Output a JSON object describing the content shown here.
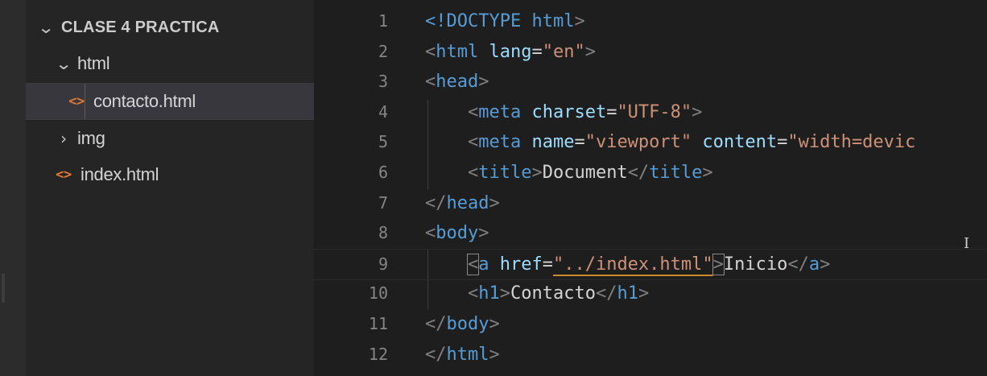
{
  "explorer": {
    "root_folder": "CLASE 4 PRACTICA",
    "items": [
      {
        "label": "html",
        "type": "folder",
        "expanded": true,
        "icon": "chevron-down-icon"
      },
      {
        "label": "contacto.html",
        "type": "file",
        "selected": true,
        "icon": "html-file-icon",
        "icon_glyph": "<>"
      },
      {
        "label": "img",
        "type": "folder",
        "expanded": false,
        "icon": "chevron-right-icon"
      },
      {
        "label": "index.html",
        "type": "file",
        "selected": false,
        "icon": "html-file-icon",
        "icon_glyph": "<>"
      }
    ]
  },
  "editor": {
    "line_numbers": [
      "1",
      "2",
      "3",
      "4",
      "5",
      "6",
      "7",
      "8",
      "9",
      "10",
      "11",
      "12"
    ],
    "lines": [
      [
        [
          "doc",
          "<!DOCTYPE "
        ],
        [
          "tag",
          "html"
        ],
        [
          "punct",
          ">"
        ]
      ],
      [
        [
          "punct",
          "<"
        ],
        [
          "tag",
          "html "
        ],
        [
          "attr",
          "lang"
        ],
        [
          "text",
          "="
        ],
        [
          "str",
          "\"en\""
        ],
        [
          "punct",
          ">"
        ]
      ],
      [
        [
          "punct",
          "<"
        ],
        [
          "tag",
          "head"
        ],
        [
          "punct",
          ">"
        ]
      ],
      [
        [
          "text",
          "    "
        ],
        [
          "punct",
          "<"
        ],
        [
          "tag",
          "meta "
        ],
        [
          "attr",
          "charset"
        ],
        [
          "text",
          "="
        ],
        [
          "str",
          "\"UTF-8\""
        ],
        [
          "punct",
          ">"
        ]
      ],
      [
        [
          "text",
          "    "
        ],
        [
          "punct",
          "<"
        ],
        [
          "tag",
          "meta "
        ],
        [
          "attr",
          "name"
        ],
        [
          "text",
          "="
        ],
        [
          "str",
          "\"viewport\" "
        ],
        [
          "attr",
          "content"
        ],
        [
          "text",
          "="
        ],
        [
          "str",
          "\"width=devic"
        ]
      ],
      [
        [
          "text",
          "    "
        ],
        [
          "punct",
          "<"
        ],
        [
          "tag",
          "title"
        ],
        [
          "punct",
          ">"
        ],
        [
          "text",
          "Document"
        ],
        [
          "punct",
          "</"
        ],
        [
          "tag",
          "title"
        ],
        [
          "punct",
          ">"
        ]
      ],
      [
        [
          "punct",
          "</"
        ],
        [
          "tag",
          "head"
        ],
        [
          "punct",
          ">"
        ]
      ],
      [
        [
          "punct",
          "<"
        ],
        [
          "tag",
          "body"
        ],
        [
          "punct",
          ">"
        ]
      ],
      [
        [
          "text",
          "    "
        ],
        [
          "punctbox",
          "<"
        ],
        [
          "tag",
          "a "
        ],
        [
          "attr",
          "href"
        ],
        [
          "text",
          "="
        ],
        [
          "strwarn",
          "\"../index.html\""
        ],
        [
          "punctbox",
          ">"
        ],
        [
          "text",
          "Inicio"
        ],
        [
          "punct",
          "</"
        ],
        [
          "tag",
          "a"
        ],
        [
          "punct",
          ">"
        ]
      ],
      [
        [
          "text",
          "    "
        ],
        [
          "punct",
          "<"
        ],
        [
          "tag",
          "h1"
        ],
        [
          "punct",
          ">"
        ],
        [
          "text",
          "Contacto"
        ],
        [
          "punct",
          "</"
        ],
        [
          "tag",
          "h1"
        ],
        [
          "punct",
          ">"
        ]
      ],
      [
        [
          "punct",
          "</"
        ],
        [
          "tag",
          "body"
        ],
        [
          "punct",
          ">"
        ]
      ],
      [
        [
          "punct",
          "</"
        ],
        [
          "tag",
          "html"
        ],
        [
          "punct",
          ">"
        ]
      ]
    ],
    "current_line": "9",
    "cursor_glyph": "I"
  },
  "colors": {
    "tag": "#569cd6",
    "attribute": "#9cdcfe",
    "string": "#ce9178",
    "text": "#d4d4d4",
    "punctuation": "#808080",
    "file_icon": "#e37933"
  }
}
